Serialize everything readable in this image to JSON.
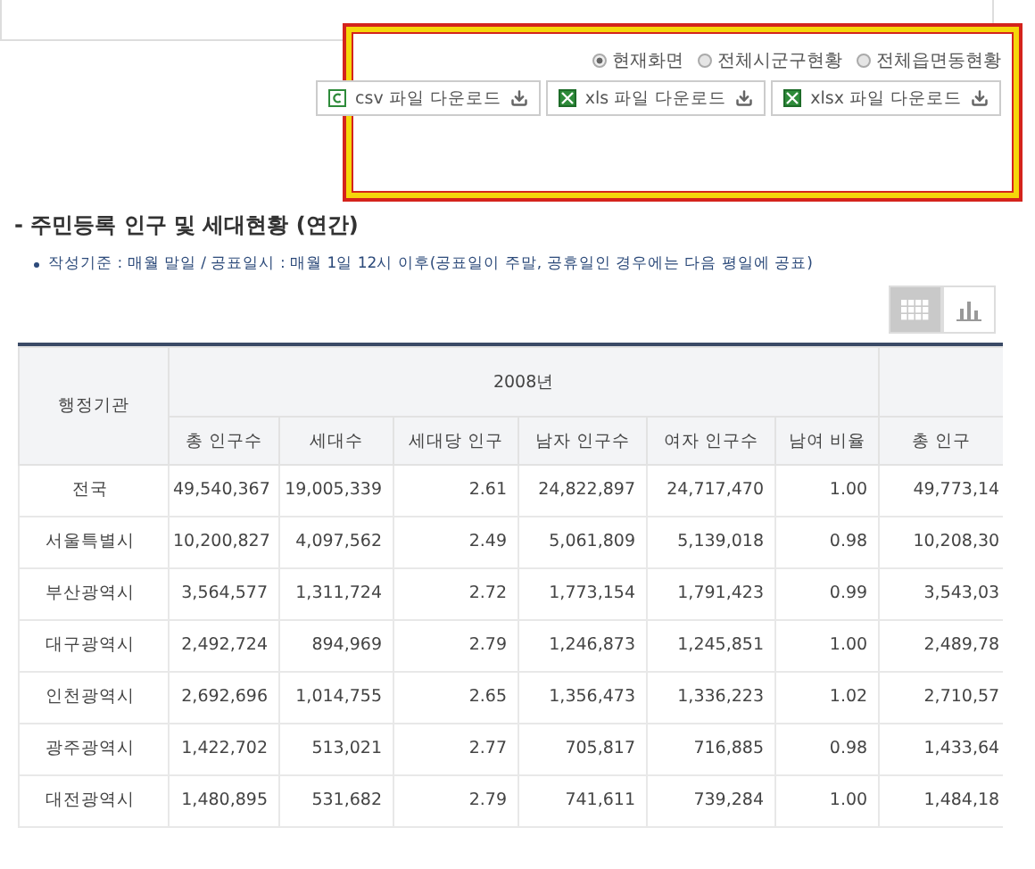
{
  "export": {
    "scope_options": [
      {
        "label": "현재화면",
        "selected": true
      },
      {
        "label": "전체시군구현황",
        "selected": false
      },
      {
        "label": "전체읍면동현황",
        "selected": false
      }
    ],
    "downloads": [
      {
        "kind": "csv",
        "label": "csv 파일 다운로드"
      },
      {
        "kind": "xls",
        "label": "xls 파일 다운로드"
      },
      {
        "kind": "xlsx",
        "label": "xlsx 파일 다운로드"
      }
    ]
  },
  "section": {
    "title": "- 주민등록 인구 및 세대현황 (연간)",
    "note": "작성기준 : 매월 말일 / 공표일시 : 매월 1일 12시 이후(공표일이 주말, 공휴일인 경우에는 다음 평일에 공표)"
  },
  "view_toggle": [
    {
      "kind": "table",
      "selected": true
    },
    {
      "kind": "chart",
      "selected": false
    }
  ],
  "table": {
    "row_header": "행정기관",
    "year_groups": [
      "2008년"
    ],
    "columns": [
      "총 인구수",
      "세대수",
      "세대당 인구",
      "남자 인구수",
      "여자 인구수",
      "남여 비율",
      "총 인구"
    ],
    "rows": [
      {
        "region": "전국",
        "values": [
          "49,540,367",
          "19,005,339",
          "2.61",
          "24,822,897",
          "24,717,470",
          "1.00",
          "49,773,14"
        ]
      },
      {
        "region": "서울특별시",
        "values": [
          "10,200,827",
          "4,097,562",
          "2.49",
          "5,061,809",
          "5,139,018",
          "0.98",
          "10,208,30"
        ]
      },
      {
        "region": "부산광역시",
        "values": [
          "3,564,577",
          "1,311,724",
          "2.72",
          "1,773,154",
          "1,791,423",
          "0.99",
          "3,543,03"
        ]
      },
      {
        "region": "대구광역시",
        "values": [
          "2,492,724",
          "894,969",
          "2.79",
          "1,246,873",
          "1,245,851",
          "1.00",
          "2,489,78"
        ]
      },
      {
        "region": "인천광역시",
        "values": [
          "2,692,696",
          "1,014,755",
          "2.65",
          "1,356,473",
          "1,336,223",
          "1.02",
          "2,710,57"
        ]
      },
      {
        "region": "광주광역시",
        "values": [
          "1,422,702",
          "513,021",
          "2.77",
          "705,817",
          "716,885",
          "0.98",
          "1,433,64"
        ]
      },
      {
        "region": "대전광역시",
        "values": [
          "1,480,895",
          "531,682",
          "2.79",
          "741,611",
          "739,284",
          "1.00",
          "1,484,18"
        ]
      }
    ]
  }
}
